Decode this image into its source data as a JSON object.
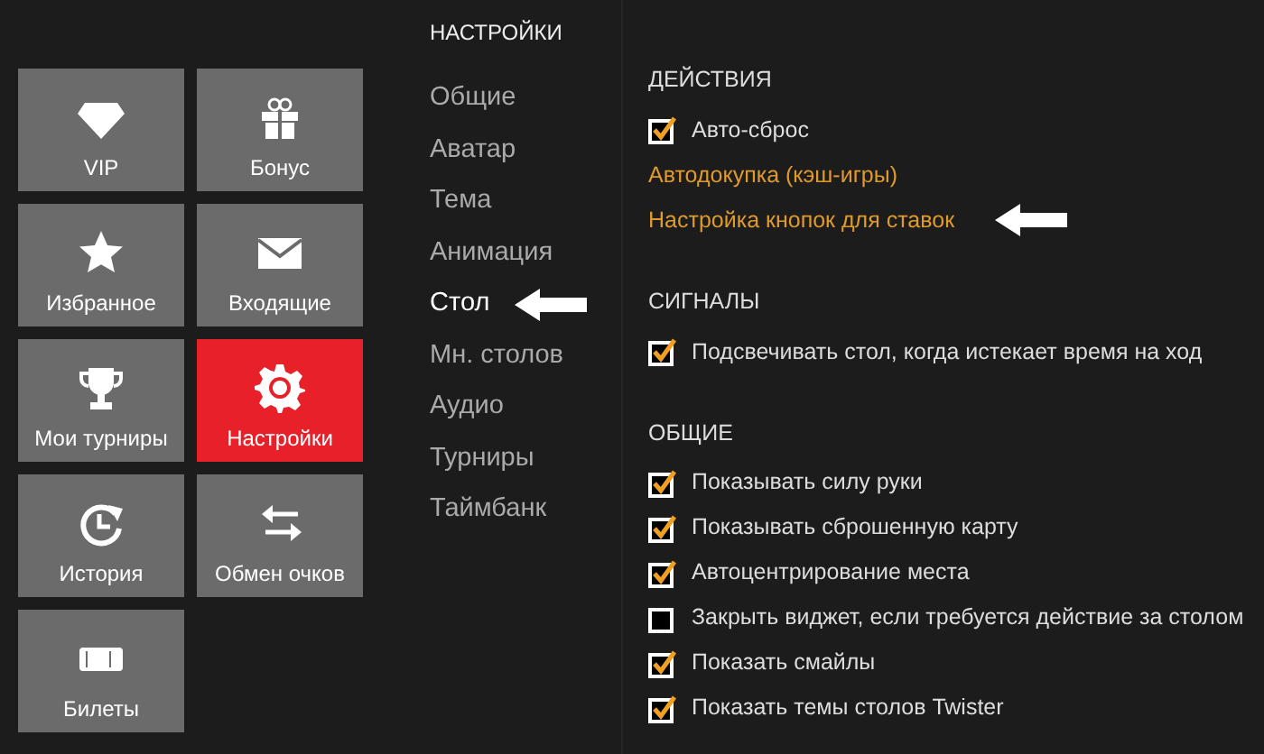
{
  "tiles": [
    {
      "label": "VIP",
      "selected": false
    },
    {
      "label": "Бонус",
      "selected": false
    },
    {
      "label": "Избранное",
      "selected": false
    },
    {
      "label": "Входящие",
      "selected": false
    },
    {
      "label": "Мои турниры",
      "selected": false
    },
    {
      "label": "Настройки",
      "selected": true
    },
    {
      "label": "История",
      "selected": false
    },
    {
      "label": "Обмен очков",
      "selected": false
    },
    {
      "label": "Билеты",
      "selected": false
    }
  ],
  "nav": {
    "title": "НАСТРОЙКИ",
    "items": [
      {
        "label": "Общие",
        "selected": false,
        "arrow": false
      },
      {
        "label": "Аватар",
        "selected": false,
        "arrow": false
      },
      {
        "label": "Тема",
        "selected": false,
        "arrow": false
      },
      {
        "label": "Анимация",
        "selected": false,
        "arrow": false
      },
      {
        "label": "Стол",
        "selected": true,
        "arrow": true
      },
      {
        "label": "Мн. столов",
        "selected": false,
        "arrow": false
      },
      {
        "label": "Аудио",
        "selected": false,
        "arrow": false
      },
      {
        "label": "Турниры",
        "selected": false,
        "arrow": false
      },
      {
        "label": "Таймбанк",
        "selected": false,
        "arrow": false
      }
    ]
  },
  "sections": [
    {
      "heading": "ДЕЙСТВИЯ",
      "items": [
        {
          "kind": "checkbox",
          "label": "Авто-сброс",
          "checked": true
        },
        {
          "kind": "link",
          "label": "Автодокупка (кэш-игры)",
          "arrow": false
        },
        {
          "kind": "link",
          "label": "Настройка кнопок для ставок",
          "arrow": true
        }
      ]
    },
    {
      "heading": "СИГНАЛЫ",
      "items": [
        {
          "kind": "checkbox",
          "label": "Подсвечивать стол, когда истекает время на ход",
          "checked": true
        }
      ]
    },
    {
      "heading": "ОБЩИЕ",
      "items": [
        {
          "kind": "checkbox",
          "label": "Показывать силу руки",
          "checked": true
        },
        {
          "kind": "checkbox",
          "label": "Показывать сброшенную карту",
          "checked": true
        },
        {
          "kind": "checkbox",
          "label": "Автоцентрирование места",
          "checked": true
        },
        {
          "kind": "checkbox",
          "label": "Закрыть виджет, если требуется действие за столом",
          "checked": false
        },
        {
          "kind": "checkbox",
          "label": "Показать смайлы",
          "checked": true
        },
        {
          "kind": "checkbox",
          "label": "Показать темы столов Twister",
          "checked": true
        }
      ]
    }
  ]
}
